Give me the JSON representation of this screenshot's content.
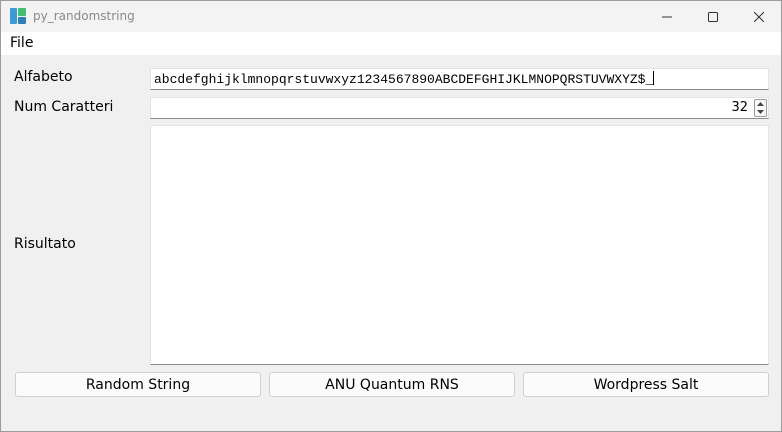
{
  "window": {
    "title": "py_randomstring",
    "icon": "app-icon",
    "controls": [
      "minimize-icon",
      "maximize-icon",
      "close-icon"
    ]
  },
  "menu": {
    "file": "File"
  },
  "form": {
    "alfabeto_label": "Alfabeto",
    "alfabeto_value": "abcdefghijklmnopqrstuvwxyz1234567890ABCDEFGHIJKLMNOPQRSTUVWXYZ$_",
    "num_label": "Num Caratteri",
    "num_value": "32",
    "risultato_label": "Risultato",
    "risultato_value": ""
  },
  "buttons": {
    "random": "Random String",
    "anu": "ANU Quantum RNS",
    "wordpress": "Wordpress Salt"
  },
  "colors": {
    "window_bg": "#f0f0f0",
    "field_bg": "#ffffff",
    "icon_blue": "#3b9bd9",
    "icon_green": "#3fbf6f"
  }
}
